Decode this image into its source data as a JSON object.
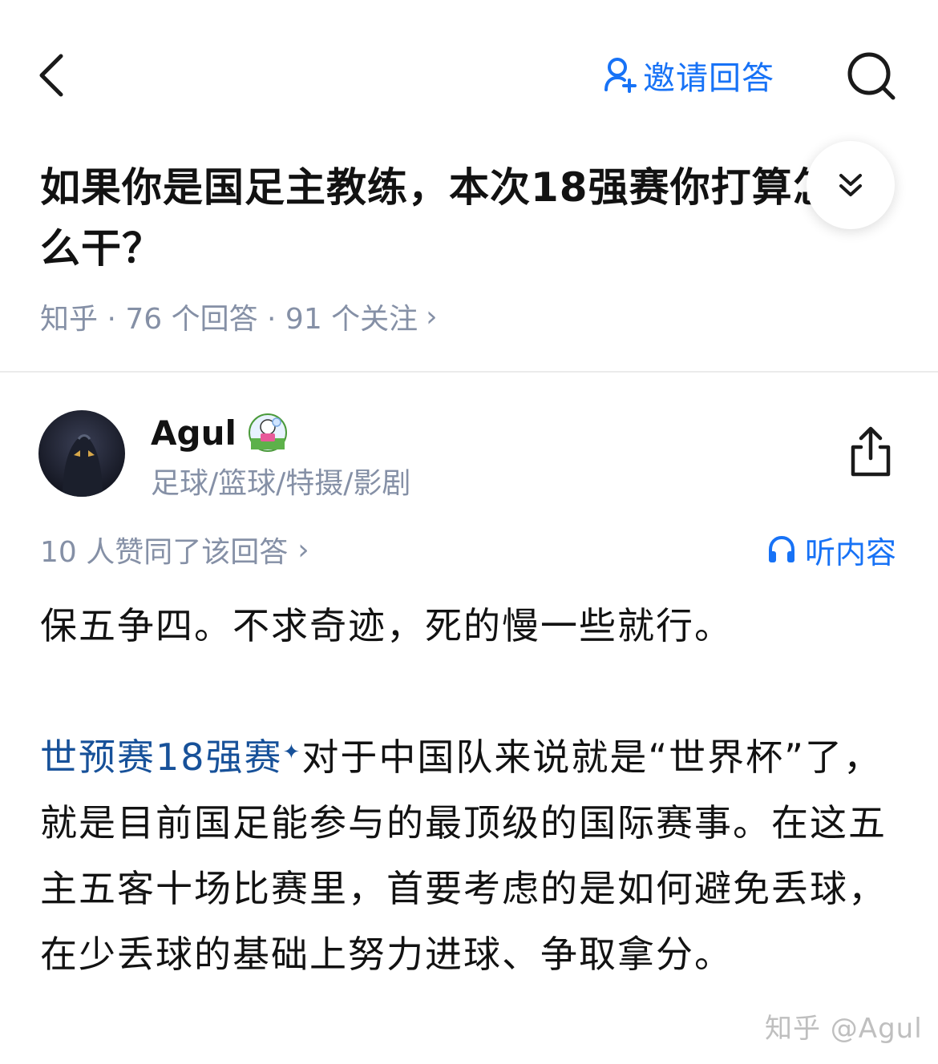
{
  "header": {
    "invite_label": "邀请回答",
    "icons": {
      "back": "chevron-left-icon",
      "invite": "person-add-icon",
      "search": "search-icon"
    }
  },
  "question": {
    "title": "如果你是国足主教练，本次18强赛你打算怎么干？",
    "meta": "知乎 · 76 个回答 · 91 个关注",
    "meta_chevron": "›"
  },
  "author": {
    "name": "Agul",
    "headline": "足球/篮球/特摄/影剧"
  },
  "answer": {
    "vote_text": "10 人赞同了该回答",
    "vote_chevron": "›",
    "listen_label": "听内容",
    "paragraph1": "保五争四。不求奇迹，死的慢一些就行。",
    "link_text": "世预赛18强赛",
    "link_mark": "✦",
    "paragraph2_rest": "对于中国队来说就是“世界杯”了，就是目前国足能参与的最顶级的国际赛事。在这五主五客十场比赛里，首要考虑的是如何避免丢球，在少丢球的基础上努力进球、争取拿分。"
  },
  "watermark": "知乎 @Agul",
  "colors": {
    "accent": "#1772F6",
    "link": "#175199",
    "meta": "#8590A6",
    "text": "#121212"
  }
}
